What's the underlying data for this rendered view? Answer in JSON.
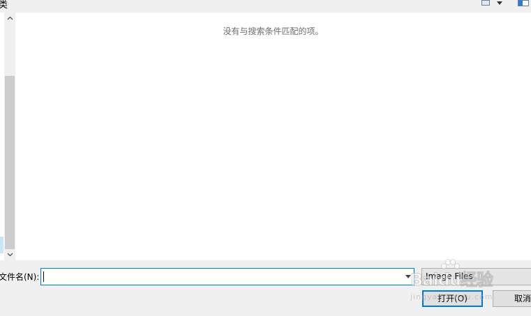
{
  "toolbar": {
    "partial_label": "类",
    "view_icon": "view-options-icon",
    "preview_icon": "preview-pane-icon"
  },
  "content": {
    "empty_message": "没有与搜索条件匹配的项。"
  },
  "footer": {
    "filename_label": "文件名(N):",
    "filename_value": "",
    "filetype_value": "Image Files",
    "open_label": "打开(O)",
    "cancel_label": "取消"
  },
  "watermark": {
    "text": "Baidu经验",
    "sub": "jingyan.baidu.com"
  },
  "colors": {
    "accent": "#0078d7",
    "scroll_thumb": "#cdcdcd",
    "background": "#f0f0f0"
  }
}
